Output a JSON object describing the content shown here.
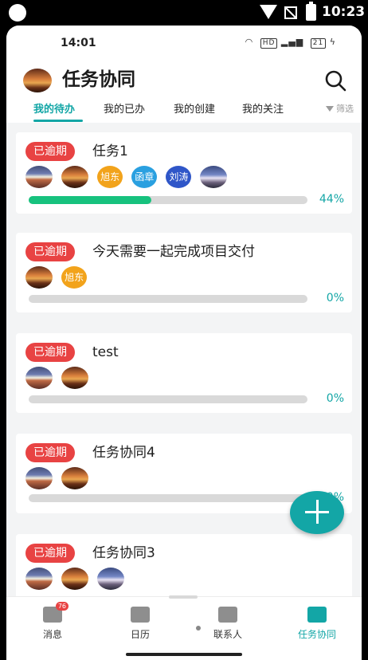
{
  "system_status": {
    "time": "10:23"
  },
  "inner_status": {
    "time": "14:01",
    "hd_label": "HD",
    "battery_label": "21"
  },
  "header": {
    "title": "任务协同"
  },
  "tabs": [
    {
      "label": "我的待办",
      "active": true
    },
    {
      "label": "我的已办",
      "active": false
    },
    {
      "label": "我的创建",
      "active": false
    },
    {
      "label": "我的关注",
      "active": false
    }
  ],
  "filter_label": "筛选",
  "tasks": [
    {
      "status": "已逾期",
      "title": "任务1",
      "progress": 44,
      "progress_label": "44%",
      "members": [
        {
          "type": "photo",
          "style": "a"
        },
        {
          "type": "photo",
          "style": "b"
        },
        {
          "type": "name",
          "text": "旭东",
          "color": "#f2a31b"
        },
        {
          "type": "name",
          "text": "函章",
          "color": "#2aa0e0"
        },
        {
          "type": "name",
          "text": "刘涛",
          "color": "#2f56c8"
        },
        {
          "type": "photo",
          "style": "c"
        }
      ]
    },
    {
      "status": "已逾期",
      "title": "今天需要一起完成项目交付",
      "progress": 0,
      "progress_label": "0%",
      "members": [
        {
          "type": "photo",
          "style": "b"
        },
        {
          "type": "name",
          "text": "旭东",
          "color": "#f2a31b"
        }
      ]
    },
    {
      "status": "已逾期",
      "title": "test",
      "progress": 0,
      "progress_label": "0%",
      "members": [
        {
          "type": "photo",
          "style": "a"
        },
        {
          "type": "photo",
          "style": "b"
        }
      ]
    },
    {
      "status": "已逾期",
      "title": "任务协同4",
      "progress": 0,
      "progress_label": "0%",
      "members": [
        {
          "type": "photo",
          "style": "a"
        },
        {
          "type": "photo",
          "style": "b"
        }
      ]
    },
    {
      "status": "已逾期",
      "title": "任务协同3",
      "progress": 0,
      "progress_label": "0%",
      "members": [
        {
          "type": "photo",
          "style": "a"
        },
        {
          "type": "photo",
          "style": "b"
        },
        {
          "type": "photo",
          "style": "c"
        }
      ]
    }
  ],
  "bottom_nav": [
    {
      "label": "消息",
      "icon": "message-icon",
      "badge": "76",
      "active": false
    },
    {
      "label": "日历",
      "icon": "calendar-icon",
      "active": false
    },
    {
      "label": "联系人",
      "icon": "contacts-icon",
      "active": false
    },
    {
      "label": "任务协同",
      "icon": "task-icon",
      "active": true
    }
  ],
  "colors": {
    "accent": "#13a6a6",
    "overdue": "#e84343",
    "progress": "#17c27e"
  }
}
